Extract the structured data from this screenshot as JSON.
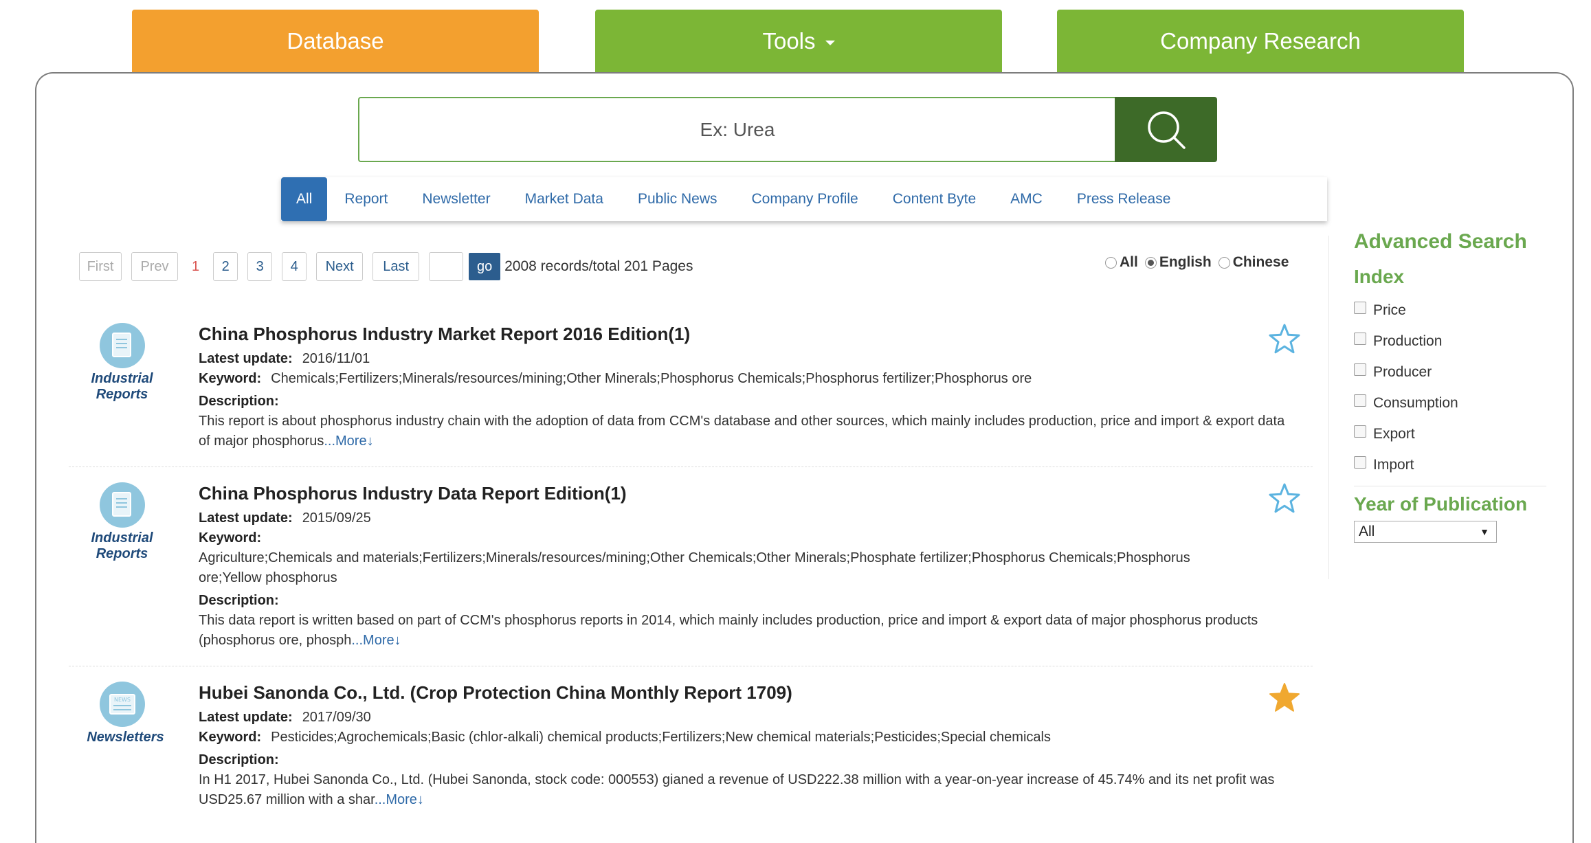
{
  "nav": {
    "database": "Database",
    "tools": "Tools",
    "company_research": "Company Research"
  },
  "search": {
    "placeholder": "Ex: Urea",
    "button_icon": "search-icon"
  },
  "type_tabs": [
    "All",
    "Report",
    "Newsletter",
    "Market Data",
    "Public News",
    "Company Profile",
    "Content Byte",
    "AMC",
    "Press Release"
  ],
  "pager": {
    "first": "First",
    "prev": "Prev",
    "pages": [
      "1",
      "2",
      "3",
      "4"
    ],
    "current": "1",
    "next": "Next",
    "last": "Last",
    "go": "go",
    "records": "2008 records/total 201 Pages"
  },
  "language": {
    "options": [
      "All",
      "English",
      "Chinese"
    ],
    "selected": "English"
  },
  "results": [
    {
      "category_line1": "Industrial",
      "category_line2": "Reports",
      "icon": "report-icon",
      "title": "China Phosphorus Industry Market Report 2016 Edition(1)",
      "latest_update_label": "Latest update:",
      "latest_update": "2016/11/01",
      "keyword_label": "Keyword:",
      "keyword": "Chemicals;Fertilizers;Minerals/resources/mining;Other Minerals;Phosphorus Chemicals;Phosphorus fertilizer;Phosphorus ore",
      "description_label": "Description:",
      "description": "This report is about phosphorus industry chain with the adoption of data from CCM's database and other sources, which mainly includes production, price and import & export data of major phosphorus",
      "more": "...More↓",
      "starred": false
    },
    {
      "category_line1": "Industrial",
      "category_line2": "Reports",
      "icon": "report-icon",
      "title": "China Phosphorus Industry Data Report Edition(1)",
      "latest_update_label": "Latest update:",
      "latest_update": "2015/09/25",
      "keyword_label": "Keyword:",
      "keyword": "Agriculture;Chemicals and materials;Fertilizers;Minerals/resources/mining;Other Chemicals;Other Minerals;Phosphate fertilizer;Phosphorus Chemicals;Phosphorus ore;Yellow phosphorus",
      "description_label": "Description:",
      "description": "This data report is written based on part of CCM's phosphorus reports in 2014, which mainly includes production, price and import & export data of major phosphorus products (phosphorus ore, phosph",
      "more": "...More↓",
      "starred": false
    },
    {
      "category_line1": "Newsletters",
      "category_line2": "",
      "icon": "newsletter-icon",
      "title": "Hubei Sanonda Co., Ltd. (Crop Protection China Monthly Report 1709)",
      "latest_update_label": "Latest update:",
      "latest_update": "2017/09/30",
      "keyword_label": "Keyword:",
      "keyword": "Pesticides;Agrochemicals;Basic (chlor-alkali) chemical products;Fertilizers;New chemical materials;Pesticides;Special chemicals",
      "description_label": "Description:",
      "description": "In H1 2017, Hubei Sanonda Co., Ltd. (Hubei Sanonda, stock code: 000553) gianed a revenue of USD222.38 million with a year-on-year increase of 45.74% and its net profit was USD25.67 million with a shar",
      "more": "...More↓",
      "starred": true
    }
  ],
  "sidebar": {
    "advanced_search": "Advanced Search",
    "index_title": "Index",
    "index_items": [
      "Price",
      "Production",
      "Producer",
      "Consumption",
      "Export",
      "Import"
    ],
    "year_title": "Year of Publication",
    "year_selected": "All"
  },
  "colors": {
    "orange": "#f3a02f",
    "green": "#7cb636",
    "dark_green": "#3d6a28",
    "accent_blue": "#2f6fb2",
    "side_green": "#6aa84f",
    "star_gold": "#f0a830",
    "star_outline": "#5bb3e0"
  }
}
